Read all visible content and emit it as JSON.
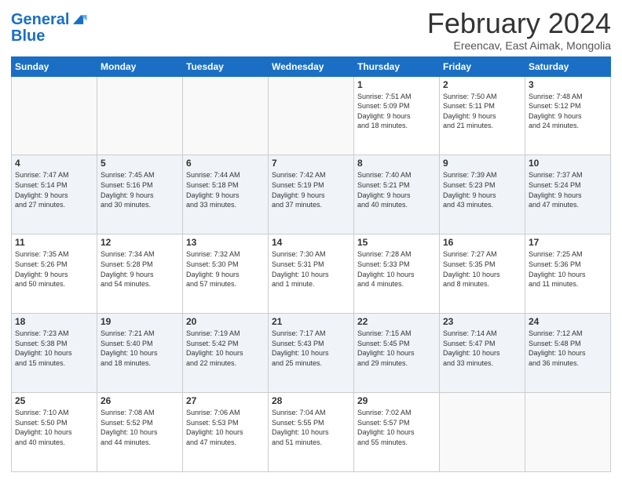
{
  "header": {
    "logo_line1": "General",
    "logo_line2": "Blue",
    "month_title": "February 2024",
    "subtitle": "Ereencav, East Aimak, Mongolia"
  },
  "weekdays": [
    "Sunday",
    "Monday",
    "Tuesday",
    "Wednesday",
    "Thursday",
    "Friday",
    "Saturday"
  ],
  "weeks": [
    [
      {
        "day": "",
        "info": ""
      },
      {
        "day": "",
        "info": ""
      },
      {
        "day": "",
        "info": ""
      },
      {
        "day": "",
        "info": ""
      },
      {
        "day": "1",
        "info": "Sunrise: 7:51 AM\nSunset: 5:09 PM\nDaylight: 9 hours\nand 18 minutes."
      },
      {
        "day": "2",
        "info": "Sunrise: 7:50 AM\nSunset: 5:11 PM\nDaylight: 9 hours\nand 21 minutes."
      },
      {
        "day": "3",
        "info": "Sunrise: 7:48 AM\nSunset: 5:12 PM\nDaylight: 9 hours\nand 24 minutes."
      }
    ],
    [
      {
        "day": "4",
        "info": "Sunrise: 7:47 AM\nSunset: 5:14 PM\nDaylight: 9 hours\nand 27 minutes."
      },
      {
        "day": "5",
        "info": "Sunrise: 7:45 AM\nSunset: 5:16 PM\nDaylight: 9 hours\nand 30 minutes."
      },
      {
        "day": "6",
        "info": "Sunrise: 7:44 AM\nSunset: 5:18 PM\nDaylight: 9 hours\nand 33 minutes."
      },
      {
        "day": "7",
        "info": "Sunrise: 7:42 AM\nSunset: 5:19 PM\nDaylight: 9 hours\nand 37 minutes."
      },
      {
        "day": "8",
        "info": "Sunrise: 7:40 AM\nSunset: 5:21 PM\nDaylight: 9 hours\nand 40 minutes."
      },
      {
        "day": "9",
        "info": "Sunrise: 7:39 AM\nSunset: 5:23 PM\nDaylight: 9 hours\nand 43 minutes."
      },
      {
        "day": "10",
        "info": "Sunrise: 7:37 AM\nSunset: 5:24 PM\nDaylight: 9 hours\nand 47 minutes."
      }
    ],
    [
      {
        "day": "11",
        "info": "Sunrise: 7:35 AM\nSunset: 5:26 PM\nDaylight: 9 hours\nand 50 minutes."
      },
      {
        "day": "12",
        "info": "Sunrise: 7:34 AM\nSunset: 5:28 PM\nDaylight: 9 hours\nand 54 minutes."
      },
      {
        "day": "13",
        "info": "Sunrise: 7:32 AM\nSunset: 5:30 PM\nDaylight: 9 hours\nand 57 minutes."
      },
      {
        "day": "14",
        "info": "Sunrise: 7:30 AM\nSunset: 5:31 PM\nDaylight: 10 hours\nand 1 minute."
      },
      {
        "day": "15",
        "info": "Sunrise: 7:28 AM\nSunset: 5:33 PM\nDaylight: 10 hours\nand 4 minutes."
      },
      {
        "day": "16",
        "info": "Sunrise: 7:27 AM\nSunset: 5:35 PM\nDaylight: 10 hours\nand 8 minutes."
      },
      {
        "day": "17",
        "info": "Sunrise: 7:25 AM\nSunset: 5:36 PM\nDaylight: 10 hours\nand 11 minutes."
      }
    ],
    [
      {
        "day": "18",
        "info": "Sunrise: 7:23 AM\nSunset: 5:38 PM\nDaylight: 10 hours\nand 15 minutes."
      },
      {
        "day": "19",
        "info": "Sunrise: 7:21 AM\nSunset: 5:40 PM\nDaylight: 10 hours\nand 18 minutes."
      },
      {
        "day": "20",
        "info": "Sunrise: 7:19 AM\nSunset: 5:42 PM\nDaylight: 10 hours\nand 22 minutes."
      },
      {
        "day": "21",
        "info": "Sunrise: 7:17 AM\nSunset: 5:43 PM\nDaylight: 10 hours\nand 25 minutes."
      },
      {
        "day": "22",
        "info": "Sunrise: 7:15 AM\nSunset: 5:45 PM\nDaylight: 10 hours\nand 29 minutes."
      },
      {
        "day": "23",
        "info": "Sunrise: 7:14 AM\nSunset: 5:47 PM\nDaylight: 10 hours\nand 33 minutes."
      },
      {
        "day": "24",
        "info": "Sunrise: 7:12 AM\nSunset: 5:48 PM\nDaylight: 10 hours\nand 36 minutes."
      }
    ],
    [
      {
        "day": "25",
        "info": "Sunrise: 7:10 AM\nSunset: 5:50 PM\nDaylight: 10 hours\nand 40 minutes."
      },
      {
        "day": "26",
        "info": "Sunrise: 7:08 AM\nSunset: 5:52 PM\nDaylight: 10 hours\nand 44 minutes."
      },
      {
        "day": "27",
        "info": "Sunrise: 7:06 AM\nSunset: 5:53 PM\nDaylight: 10 hours\nand 47 minutes."
      },
      {
        "day": "28",
        "info": "Sunrise: 7:04 AM\nSunset: 5:55 PM\nDaylight: 10 hours\nand 51 minutes."
      },
      {
        "day": "29",
        "info": "Sunrise: 7:02 AM\nSunset: 5:57 PM\nDaylight: 10 hours\nand 55 minutes."
      },
      {
        "day": "",
        "info": ""
      },
      {
        "day": "",
        "info": ""
      }
    ]
  ]
}
